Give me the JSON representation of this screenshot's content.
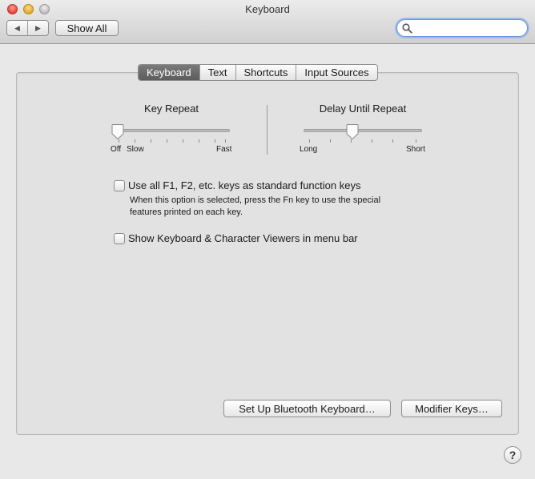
{
  "window": {
    "title": "Keyboard"
  },
  "toolbar": {
    "back_icon": "back-arrow-icon",
    "forward_icon": "forward-arrow-icon",
    "show_all_label": "Show All",
    "search_placeholder": "",
    "search_value": ""
  },
  "tabs": [
    {
      "label": "Keyboard",
      "selected": true
    },
    {
      "label": "Text",
      "selected": false
    },
    {
      "label": "Shortcuts",
      "selected": false
    },
    {
      "label": "Input Sources",
      "selected": false
    }
  ],
  "key_repeat": {
    "title": "Key Repeat",
    "off_label": "Off",
    "slow_label": "Slow",
    "fast_label": "Fast",
    "value": 0
  },
  "delay_until_repeat": {
    "title": "Delay Until Repeat",
    "long_label": "Long",
    "short_label": "Short",
    "value": 0.4
  },
  "options": {
    "fn_keys": {
      "label": "Use all F1, F2, etc. keys as standard function keys",
      "help_line1": "When this option is selected, press the Fn key to use the special",
      "help_line2": "features printed on each key.",
      "checked": false
    },
    "viewers": {
      "label": "Show Keyboard & Character Viewers in menu bar",
      "checked": false
    }
  },
  "buttons": {
    "bluetooth_label": "Set Up Bluetooth Keyboard…",
    "modifier_label": "Modifier Keys…",
    "help_label": "?"
  }
}
